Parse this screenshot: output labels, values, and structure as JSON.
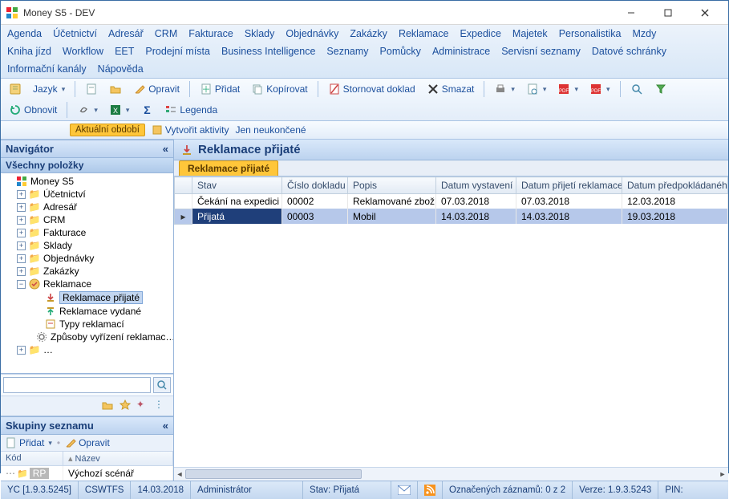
{
  "window": {
    "title": "Money S5 - DEV"
  },
  "menu": {
    "row1": [
      "Agenda",
      "Účetnictví",
      "Adresář",
      "CRM",
      "Fakturace",
      "Sklady",
      "Objednávky",
      "Zakázky",
      "Reklamace",
      "Expedice",
      "Majetek",
      "Personalistika",
      "Mzdy"
    ],
    "row2": [
      "Kniha jízd",
      "Workflow",
      "EET",
      "Prodejní místa",
      "Business Intelligence",
      "Seznamy",
      "Pomůcky",
      "Administrace",
      "Servisní seznamy",
      "Datové schránky"
    ],
    "row3": [
      "Informační kanály",
      "Nápověda"
    ]
  },
  "toolbar": {
    "jazyk": "Jazyk",
    "opravit": "Opravit",
    "pridat": "Přidat",
    "kopirovat": "Kopírovat",
    "stornovat": "Stornovat doklad",
    "smazat": "Smazat",
    "obnovit": "Obnovit",
    "legenda": "Legenda"
  },
  "toolbar2": {
    "aktualni": "Aktuální období",
    "vytvorit": "Vytvořit aktivity",
    "neukoncene": "Jen neukončené"
  },
  "nav": {
    "title": "Navigátor",
    "all_items": "Všechny položky",
    "tree": {
      "root": "Money S5",
      "items": [
        "Účetnictví",
        "Adresář",
        "CRM",
        "Fakturace",
        "Sklady",
        "Objednávky",
        "Zakázky"
      ],
      "reklamace": "Reklamace",
      "reklamace_children": [
        "Reklamace přijaté",
        "Reklamace vydané",
        "Typy reklamací",
        "Způsoby vyřízení reklamac…"
      ]
    },
    "groups": {
      "title": "Skupiny seznamu",
      "pridat": "Přidat",
      "opravit": "Opravit",
      "col_kod": "Kód",
      "col_nazev": "Název",
      "row_code": "RP",
      "row_name": "Výchozí scénář"
    }
  },
  "main": {
    "title": "Reklamace přijaté",
    "tab": "Reklamace přijaté",
    "columns": [
      "Stav",
      "Číslo dokladu",
      "Popis",
      "Datum vystavení",
      "Datum přijetí reklamace",
      "Datum předpokládaného vy"
    ],
    "rows": [
      {
        "stav": "Čekání na expedici",
        "cislo": "00002",
        "popis": "Reklamované zboží",
        "vyst": "07.03.2018",
        "prij": "07.03.2018",
        "pred": "12.03.2018"
      },
      {
        "stav": "Přijatá",
        "cislo": "00003",
        "popis": "Mobil",
        "vyst": "14.03.2018",
        "prij": "14.03.2018",
        "pred": "19.03.2018"
      }
    ]
  },
  "status": {
    "yc": "YC [1.9.3.5245]",
    "host": "CSWTFS",
    "date": "14.03.2018",
    "user": "Administrátor",
    "stav": "Stav: Přijatá",
    "oznacenych": "Označených záznamů: 0 z 2",
    "verze": "Verze: 1.9.3.5243",
    "pin": "PIN:"
  }
}
